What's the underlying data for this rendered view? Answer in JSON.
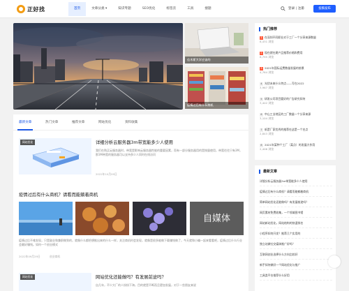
{
  "header": {
    "logo_text": "正好找",
    "nav": [
      "首页",
      "文章分类 ▾",
      "知识专题",
      "SEO优化",
      "标签云",
      "工具",
      "搜题"
    ],
    "active_nav": 0,
    "login_text": "登录 | 注册",
    "cta_label": "投稿发布"
  },
  "slider": {
    "thumb1_caption": "佳木斯大学应该的",
    "thumb2_caption": "疫情过后有什么商机"
  },
  "tabs": [
    "最新文章",
    "热门文章",
    "推荐文章",
    "网站优化",
    "资料收集"
  ],
  "articles": [
    {
      "badge": "网站优化",
      "title": "详细分析云服务器3m带宽能多少人使用",
      "excerpt": "我们在购买云服务器时，带宽是影响云服务器性能的重要因素，而有一部分服务器用的是按量使用，带宽往往只有3M，那3M带宽的服务器可以支持多少人同时在线访问",
      "meta": "2022年10月09日"
    },
    {
      "title": "疫情过后有什么商机？请看而能躺着商机",
      "excerpt": "疫情过后不难发现，只是副业和兼职做到的，就像什么都把想推出来的什么一样，关注商机时会发现，就像是很多能做下载赚钱做了，今天就和小编一起来看看吧，疫情过后什么行业会最好赚钱。如何一个创业模式",
      "meta": "2022年09月29日",
      "tag": "创业商机"
    },
    {
      "badge": "网站优化",
      "title": "网站优化还能做吗？有发展前途吗？",
      "excerpt": "自几年，不少大厂的人纷纷下海，目的就是不断而且更加发展，对于一些朋友来说",
      "meta": ""
    }
  ],
  "grid_overlay_text": "自媒体",
  "sidebar": {
    "hot_title": "热门推荐",
    "hot_items": [
      {
        "n": "1",
        "text": "在深圳不同职业对于工厂一个分享来源数量",
        "views": "8,431 浏览"
      },
      {
        "n": "2",
        "text": "现在就在建产品推荐价格和费用",
        "views": "6,795 浏览"
      },
      {
        "n": "3",
        "text": "2021年国际运费数量发展的前景",
        "views": "4,764 浏览"
      },
      {
        "n": "4",
        "text": "光伏未来什么特点——写在2022",
        "views": "3,967 浏览"
      },
      {
        "n": "5",
        "text": "研发公司项目要好的广告研究如何",
        "views": "3,402 浏览"
      },
      {
        "n": "6",
        "text": "中山工业地区的工厂数量一个分享来源",
        "views": "3,104 浏览"
      },
      {
        "n": "7",
        "text": "纸是厂家优秀的推荐在这是一个名点",
        "views": "2,843 浏览"
      },
      {
        "n": "8",
        "text": "2021年某种个工厂（某点）的发展大作用",
        "views": "2,406 浏览"
      }
    ],
    "latest_title": "最新文章",
    "latest_items": [
      "详细分析云服务器3m带宽能多少人使用",
      "疫情过后有什么商机？请看而能躺着商机",
      "简单网站优化还能做吗？有发展前途吗？",
      "网页素材免费收集，一个领域图书馆",
      "网站新站优化，网站结构的快速排名",
      "小程序如何开发？推荐几个实用的",
      "独立站做社交媒体推广好吗？",
      "互联网创业选择什么方向比较好",
      "新手如何做好一个网站优化与推广",
      "工具类平台推荐什么好用"
    ]
  }
}
